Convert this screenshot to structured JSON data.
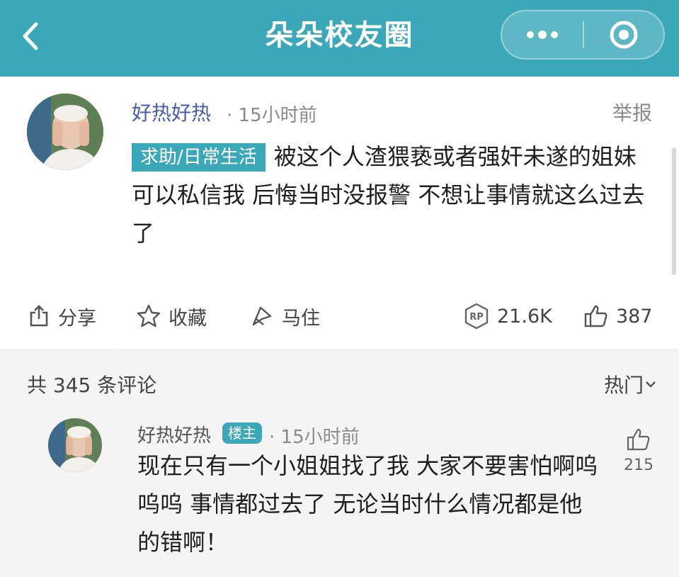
{
  "header": {
    "title": "朵朵校友圈",
    "back_icon": "chevron-left-icon",
    "more_icon": "more-dots-icon",
    "close_icon": "target-circle-icon",
    "color": "#3aa8b8"
  },
  "post": {
    "username": "好热好热",
    "time": "· 15小时前",
    "report": "举报",
    "tag": "求助/日常生活",
    "content": "被这个人渣猥亵或者强奸未遂的姐妹可以私信我 后悔当时没报警 不想让事情就这么过去了",
    "actions": {
      "share": "分享",
      "favorite": "收藏",
      "reply": "马住",
      "views": "21.6K",
      "likes": "387"
    }
  },
  "comments": {
    "count_label": "共 345 条评论",
    "sort_label": "热门",
    "items": [
      {
        "username": "好热好热",
        "badge": "楼主",
        "time": "· 15小时前",
        "content": "现在只有一个小姐姐找了我 大家不要害怕啊呜呜呜 事情都过去了 无论当时什么情况都是他的错啊！",
        "likes": "215"
      }
    ]
  }
}
